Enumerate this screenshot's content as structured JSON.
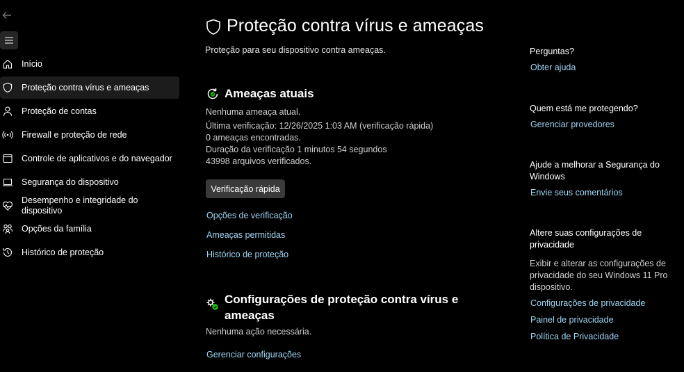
{
  "sidebar": {
    "items": [
      {
        "label": "Início",
        "icon": "home-icon"
      },
      {
        "label": "Proteção contra vírus e ameaças",
        "icon": "shield-icon",
        "active": true
      },
      {
        "label": "Proteção de contas",
        "icon": "person-icon"
      },
      {
        "label": "Firewall e proteção de rede",
        "icon": "wifi-signal-icon"
      },
      {
        "label": "Controle de aplicativos e do navegador",
        "icon": "app-window-icon"
      },
      {
        "label": "Segurança do dispositivo",
        "icon": "laptop-icon"
      },
      {
        "label": "Desempenho e integridade do dispositivo",
        "icon": "heart-pulse-icon"
      },
      {
        "label": "Opções da família",
        "icon": "family-icon"
      },
      {
        "label": "Histórico de proteção",
        "icon": "history-icon"
      }
    ]
  },
  "main": {
    "title": "Proteção contra vírus e ameaças",
    "subtitle": "Proteção para seu dispositivo contra ameaças.",
    "current_threats": {
      "title": "Ameaças atuais",
      "lines": [
        "Nenhuma ameaça atual.",
        "Última verificação: 12/26/2025 1:03 AM (verificação rápida)",
        "0 ameaças encontradas.",
        "Duração da verificação 1 minutos 54 segundos",
        "43998 arquivos verificados."
      ],
      "quick_scan_label": "Verificação rápida",
      "links": [
        "Opções de verificação",
        "Ameaças permitidas",
        "Histórico de proteção"
      ]
    },
    "settings": {
      "title_line1": "Configurações de proteção contra vírus e",
      "title_line2": "ameaças",
      "status": "Nenhuma ação necessária.",
      "link": "Gerenciar configurações"
    }
  },
  "right": {
    "questions_title": "Perguntas?",
    "get_help": "Obter ajuda",
    "who_title": "Quem está me protegendo?",
    "manage_providers": "Gerenciar provedores",
    "improve_title_line1": "Ajude a melhorar a Segurança do",
    "improve_title_line2": "Windows",
    "send_feedback": "Envie seus comentários",
    "privacy_title_line1": "Altere suas configurações de",
    "privacy_title_line2": "privacidade",
    "privacy_text_line1": "Exibir e alterar as configurações de",
    "privacy_text_line2": "privacidade do seu Windows 11 Pro",
    "privacy_text_line3": "dispositivo.",
    "privacy_links": [
      "Configurações de privacidade",
      "Painel de privacidade",
      "Política de Privacidade"
    ]
  },
  "colors": {
    "background": "#000000",
    "link": "#9fd6f5",
    "accent_green": "#16c60c",
    "nav_active": "#1c1c1c"
  }
}
